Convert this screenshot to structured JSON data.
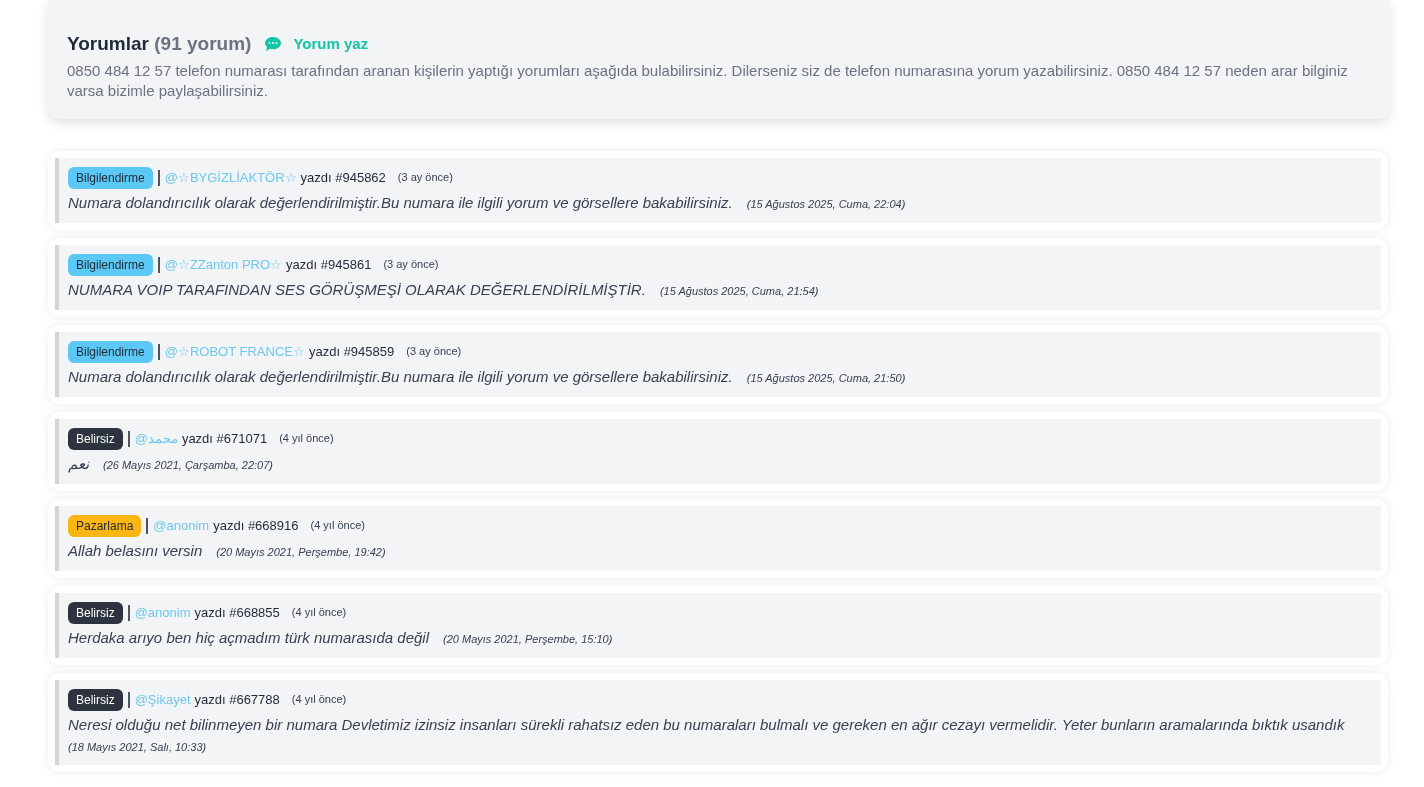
{
  "header": {
    "title": "Yorumlar",
    "count": "(91 yorum)",
    "write_link": "Yorum yaz",
    "description": "0850 484 12 57 telefon numarası tarafından aranan kişilerin yaptığı yorumları aşağıda bulabilirsiniz. Dilerseniz siz de telefon numarasına yorum yazabilirsiniz. 0850 484 12 57 neden arar bilginiz varsa bizimle paylaşabilirsiniz."
  },
  "comments": [
    {
      "tag": {
        "label": "Bilgilendirme",
        "kind": "info"
      },
      "user": "@☆BYGİZLİAKTÖR☆",
      "wrote": "yazdı #945862",
      "ago": "(3 ay önce)",
      "text": "Numara dolandırıcılık olarak değerlendirilmiştir.Bu numara ile ilgili yorum ve görsellere bakabilirsiniz.",
      "date": "(15 Ağustos 2025, Cuma, 22:04)"
    },
    {
      "tag": {
        "label": "Bilgilendirme",
        "kind": "info"
      },
      "user": "@☆ZZanton PRO☆",
      "wrote": "yazdı #945861",
      "ago": "(3 ay önce)",
      "text": "NUMARA VOIP TARAFINDAN SES GÖRÜŞMEŞİ OLARAK DEĞERLENDİRİLMİŞTİR.",
      "date": "(15 Ağustos 2025, Cuma, 21:54)"
    },
    {
      "tag": {
        "label": "Bilgilendirme",
        "kind": "info"
      },
      "user": "@☆ROBOT FRANCE☆",
      "wrote": "yazdı #945859",
      "ago": "(3 ay önce)",
      "text": "Numara dolandırıcılık olarak değerlendirilmiştir.Bu numara ile ilgili yorum ve görsellere bakabilirsiniz.",
      "date": "(15 Ağustos 2025, Cuma, 21:50)"
    },
    {
      "tag": {
        "label": "Belirsiz",
        "kind": "dark"
      },
      "user": "@محمد",
      "wrote": "yazdı #671071",
      "ago": "(4 yıl önce)",
      "text": "نعم",
      "date": "(26 Mayıs 2021, Çarşamba, 22:07)"
    },
    {
      "tag": {
        "label": "Pazarlama",
        "kind": "warning"
      },
      "user": "@anonim",
      "wrote": "yazdı #668916",
      "ago": "(4 yıl önce)",
      "text": "Allah belasını versin",
      "date": "(20 Mayıs 2021, Perşembe, 19:42)"
    },
    {
      "tag": {
        "label": "Belirsiz",
        "kind": "dark"
      },
      "user": "@anonim",
      "wrote": "yazdı #668855",
      "ago": "(4 yıl önce)",
      "text": "Herdaka arıyo ben hiç açmadım türk numarasıda değil",
      "date": "(20 Mayıs 2021, Perşembe, 15:10)"
    },
    {
      "tag": {
        "label": "Belirsiz",
        "kind": "dark"
      },
      "user": "@Şikayet",
      "wrote": "yazdı #667788",
      "ago": "(4 yıl önce)",
      "text": "Neresi olduğu net bilinmeyen bir numara Devletimiz izinsiz insanları sürekli rahatsız eden bu numaraları bulmalı ve gereken en ağır cezayı vermelidir. Yeter bunların aramalarında bıktık usandık",
      "date": "(18 Mayıs 2021, Salı, 10:33)"
    }
  ]
}
